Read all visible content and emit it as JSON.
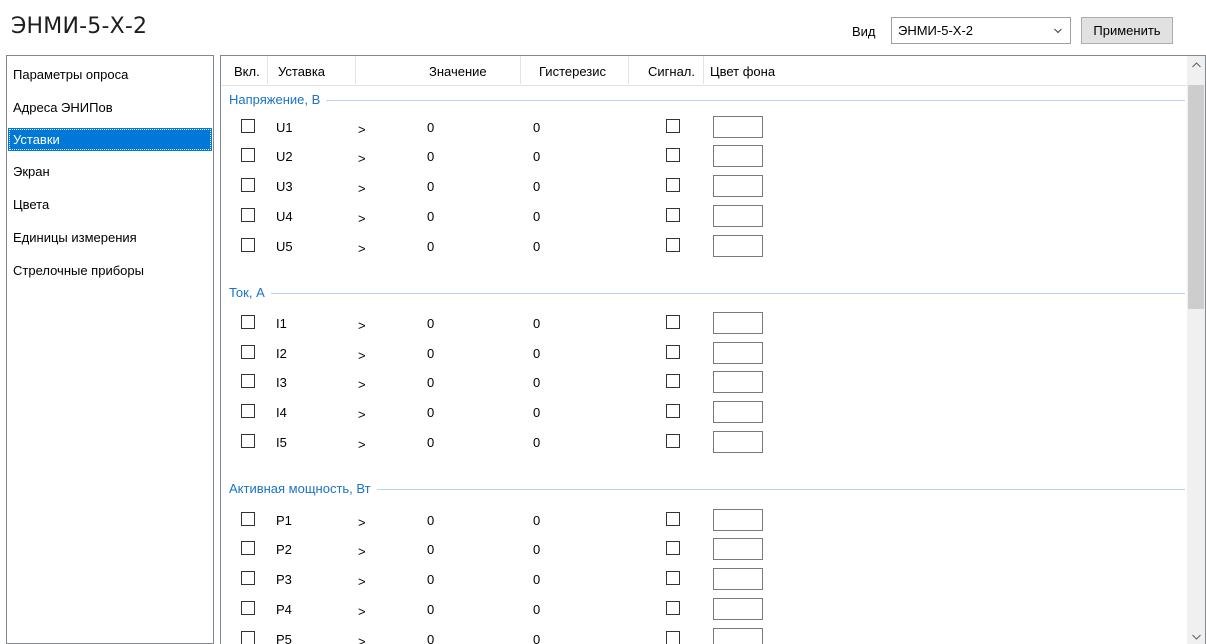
{
  "app": {
    "title": "ЭНМИ-5-Х-2"
  },
  "toolbar": {
    "view_label": "Вид",
    "view_value": "ЭНМИ-5-Х-2",
    "apply_label": "Применить"
  },
  "sidebar": {
    "items": [
      {
        "label": "Параметры опроса",
        "selected": false
      },
      {
        "label": "Адреса ЭНИПов",
        "selected": false
      },
      {
        "label": "Уставки",
        "selected": true
      },
      {
        "label": "Экран",
        "selected": false
      },
      {
        "label": "Цвета",
        "selected": false
      },
      {
        "label": "Единицы измерения",
        "selected": false
      },
      {
        "label": "Стрелочные приборы",
        "selected": false
      }
    ]
  },
  "table": {
    "headers": {
      "enabled": "Вкл.",
      "setpoint": "Уставка",
      "value": "Значение",
      "hysteresis": "Гистерезис",
      "signal": "Сигнал.",
      "bg_color": "Цвет фона"
    },
    "groups": [
      {
        "label": "Напряжение, В",
        "rows": [
          {
            "name": "U1",
            "op": ">",
            "value": "0",
            "hysteresis": "0",
            "enabled": false,
            "signal": false
          },
          {
            "name": "U2",
            "op": ">",
            "value": "0",
            "hysteresis": "0",
            "enabled": false,
            "signal": false
          },
          {
            "name": "U3",
            "op": ">",
            "value": "0",
            "hysteresis": "0",
            "enabled": false,
            "signal": false
          },
          {
            "name": "U4",
            "op": ">",
            "value": "0",
            "hysteresis": "0",
            "enabled": false,
            "signal": false
          },
          {
            "name": "U5",
            "op": ">",
            "value": "0",
            "hysteresis": "0",
            "enabled": false,
            "signal": false
          }
        ]
      },
      {
        "label": "Ток, А",
        "rows": [
          {
            "name": "I1",
            "op": ">",
            "value": "0",
            "hysteresis": "0",
            "enabled": false,
            "signal": false
          },
          {
            "name": "I2",
            "op": ">",
            "value": "0",
            "hysteresis": "0",
            "enabled": false,
            "signal": false
          },
          {
            "name": "I3",
            "op": ">",
            "value": "0",
            "hysteresis": "0",
            "enabled": false,
            "signal": false
          },
          {
            "name": "I4",
            "op": ">",
            "value": "0",
            "hysteresis": "0",
            "enabled": false,
            "signal": false
          },
          {
            "name": "I5",
            "op": ">",
            "value": "0",
            "hysteresis": "0",
            "enabled": false,
            "signal": false
          }
        ]
      },
      {
        "label": "Активная мощность, Вт",
        "rows": [
          {
            "name": "P1",
            "op": ">",
            "value": "0",
            "hysteresis": "0",
            "enabled": false,
            "signal": false
          },
          {
            "name": "P2",
            "op": ">",
            "value": "0",
            "hysteresis": "0",
            "enabled": false,
            "signal": false
          },
          {
            "name": "P3",
            "op": ">",
            "value": "0",
            "hysteresis": "0",
            "enabled": false,
            "signal": false
          },
          {
            "name": "P4",
            "op": ">",
            "value": "0",
            "hysteresis": "0",
            "enabled": false,
            "signal": false
          },
          {
            "name": "P5",
            "op": ">",
            "value": "0",
            "hysteresis": "0",
            "enabled": false,
            "signal": false
          }
        ]
      }
    ]
  },
  "colors": {
    "selection": "#0078d7",
    "group_label": "#1a73c8",
    "group_line": "#b9d4ee"
  },
  "icons": {
    "dropdown": "chevron-down-icon",
    "scroll_up": "chevron-up-icon",
    "scroll_down": "chevron-down-icon"
  }
}
